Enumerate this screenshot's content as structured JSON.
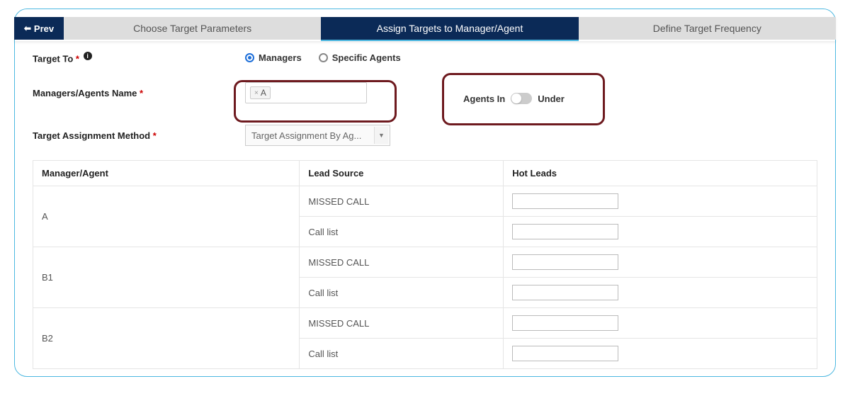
{
  "nav": {
    "prev_label": "Prev",
    "tabs": [
      {
        "label": "Choose Target Parameters"
      },
      {
        "label": "Assign Targets to Manager/Agent"
      },
      {
        "label": "Define Target Frequency"
      }
    ]
  },
  "form": {
    "target_to_label": "Target To",
    "radios": {
      "managers": "Managers",
      "specific_agents": "Specific Agents"
    },
    "managers_name_label": "Managers/Agents Name",
    "chip_value": "A",
    "toggle": {
      "left": "Agents In",
      "right": "Under"
    },
    "assignment_method_label": "Target Assignment Method",
    "assignment_method_value": "Target Assignment By Ag..."
  },
  "table": {
    "headers": {
      "agent": "Manager/Agent",
      "source": "Lead Source",
      "value": "Hot Leads"
    },
    "rows": [
      {
        "agent": "A",
        "sources": [
          "MISSED CALL",
          "Call list"
        ]
      },
      {
        "agent": "B1",
        "sources": [
          "MISSED CALL",
          "Call list"
        ]
      },
      {
        "agent": "B2",
        "sources": [
          "MISSED CALL",
          "Call list"
        ]
      }
    ]
  }
}
